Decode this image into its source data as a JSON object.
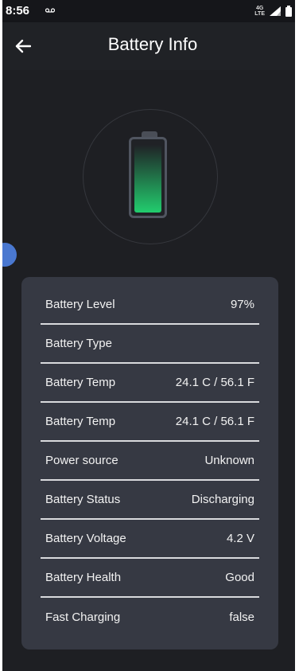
{
  "status_bar": {
    "time": "8:56",
    "lte": "4G\nLTE"
  },
  "app_bar": {
    "title": "Battery Info"
  },
  "battery": {
    "level_fraction": 0.97,
    "fill_color": "#22cd6e"
  },
  "info": {
    "rows": [
      {
        "label": "Battery Level",
        "value": "97%"
      },
      {
        "label": "Battery Type",
        "value": ""
      },
      {
        "label": "Battery Temp",
        "value": "24.1 C / 56.1 F"
      },
      {
        "label": "Battery Temp",
        "value": "24.1 C / 56.1 F"
      },
      {
        "label": "Power source",
        "value": "Unknown"
      },
      {
        "label": "Battery Status",
        "value": "Discharging"
      },
      {
        "label": "Battery Voltage",
        "value": "4.2 V"
      },
      {
        "label": "Battery Health",
        "value": "Good"
      },
      {
        "label": "Fast Charging",
        "value": "false"
      }
    ]
  },
  "colors": {
    "background": "#202226",
    "card": "#363943",
    "accent_dot": "#4a78d0"
  }
}
